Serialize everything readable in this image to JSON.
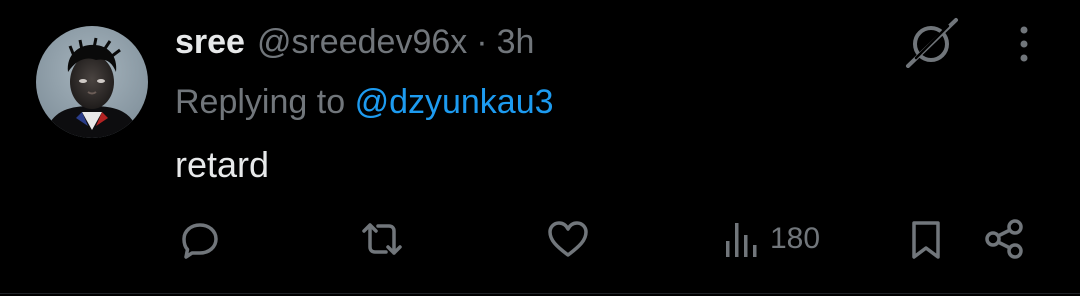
{
  "tweet": {
    "author": {
      "display_name": "sree",
      "handle": "@sreedev96x"
    },
    "separator": "·",
    "time": "3h",
    "reply": {
      "prefix": "Replying to",
      "mention": "@dzyunkau3"
    },
    "text": "retard",
    "stats": {
      "views": "180"
    }
  },
  "icons": {
    "grok": "grok-icon",
    "more": "more-vertical-icon",
    "reply": "reply-icon",
    "retweet": "retweet-icon",
    "like": "heart-icon",
    "views": "analytics-icon",
    "bookmark": "bookmark-icon",
    "share": "share-icon"
  },
  "colors": {
    "background": "#000000",
    "primary_text": "#e7e9ea",
    "secondary_text": "#71767b",
    "link": "#1d9bf0",
    "icon": "#71767b"
  }
}
